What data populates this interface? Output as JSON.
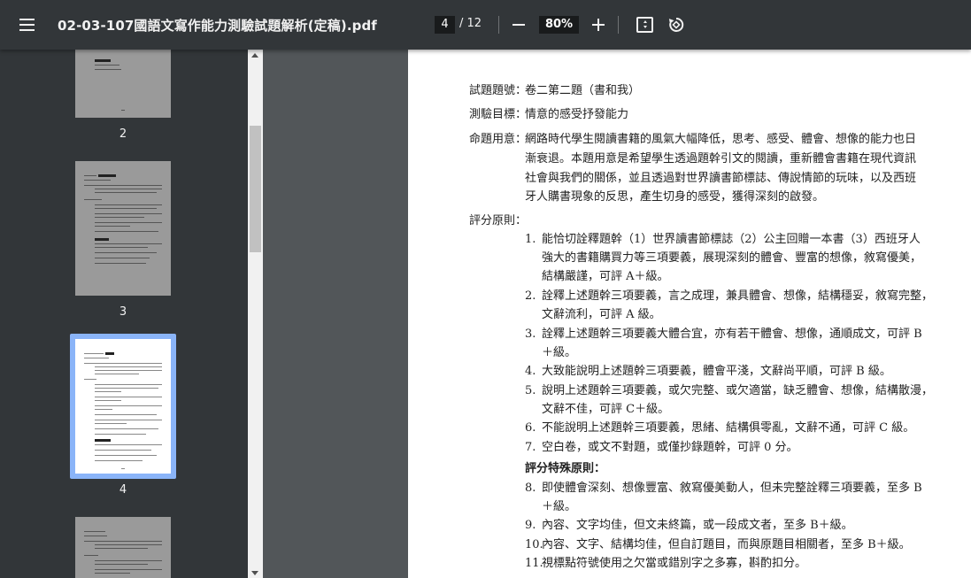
{
  "toolbar": {
    "title": "02-03-107國語文寫作能力測驗試題解析(定稿).pdf",
    "current_page": "4",
    "total_pages": "/ 12",
    "zoom": "80%"
  },
  "sidebar": {
    "thumbnails": [
      {
        "num": "2"
      },
      {
        "num": "3"
      },
      {
        "num": "4"
      }
    ]
  },
  "page": {
    "rows": [
      {
        "label": "試題題號：",
        "text": "卷二第二題（書和我）"
      },
      {
        "label": "測驗目標：",
        "text": "情意的感受抒發能力"
      },
      {
        "label": "命題用意：",
        "text": "網路時代學生閱讀書籍的風氣大幅降低，思考、感受、體會、想像的能力也日"
      },
      {
        "text": "漸衰退。本題用意是希望學生透過題幹引文的閱讀，重新體會書籍在現代資訊"
      },
      {
        "text": "社會與我們的關係，並且透過對世界讀書節標誌、傳說情節的玩味，以及西班"
      },
      {
        "text": "牙人購書現象的反思，產生切身的感受，獲得深刻的啟發。"
      },
      {
        "label": "評分原則："
      }
    ],
    "items": [
      {
        "num": "1.",
        "lines": [
          "能恰切詮釋題幹（1）世界讀書節標誌（2）公主回贈一本書（3）西班牙人",
          "強大的書籍購買力等三項要義，展現深刻的體會、豐富的想像，敘寫優美，",
          "結構嚴謹，可評 A＋級。"
        ]
      },
      {
        "num": "2.",
        "lines": [
          "詮釋上述題幹三項要義，言之成理，兼具體會、想像，結構穩妥，敘寫完整，",
          "文辭流利，可評 A 級。"
        ]
      },
      {
        "num": "3.",
        "lines": [
          "詮釋上述題幹三項要義大體合宜，亦有若干體會、想像，通順成文，可評 B",
          "＋級。"
        ]
      },
      {
        "num": "4.",
        "lines": [
          "大致能說明上述題幹三項要義，體會平淺，文辭尚平順，可評 B 級。"
        ]
      },
      {
        "num": "5.",
        "lines": [
          "說明上述題幹三項要義，或欠完整、或欠適當，缺乏體會、想像，結構散漫，",
          "文辭不佳，可評 C＋級。"
        ]
      },
      {
        "num": "6.",
        "lines": [
          "不能說明上述題幹三項要義，思緒、結構俱零亂，文辭不通，可評 C 級。"
        ]
      },
      {
        "num": "7.",
        "lines": [
          "空白卷，或文不對題，或僅抄錄題幹，可評 0 分。"
        ]
      }
    ],
    "special_heading": "評分特殊原則：",
    "special_items": [
      {
        "num": "8.",
        "lines": [
          "即使體會深刻、想像豐富、敘寫優美動人，但未完整詮釋三項要義，至多 B",
          "＋級。"
        ]
      },
      {
        "num": "9.",
        "lines": [
          "內容、文字均佳，但文未終篇，或一段成文者，至多 B＋級。"
        ]
      },
      {
        "num": "10.",
        "lines": [
          "內容、文字、結構均佳，但自訂題目，而與原題目相關者，至多 B＋級。"
        ]
      },
      {
        "num": "11.",
        "lines": [
          "視標點符號使用之欠當或錯別字之多寡，斟酌扣分。"
        ]
      }
    ]
  }
}
